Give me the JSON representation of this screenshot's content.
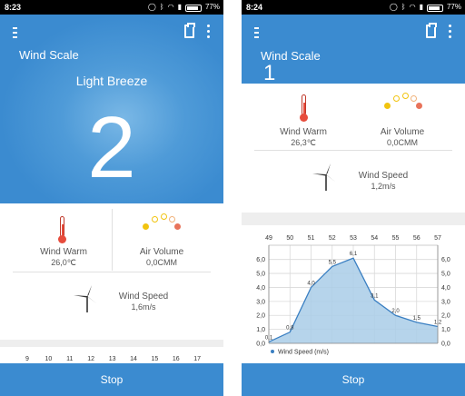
{
  "screen1": {
    "status": {
      "time": "8:23",
      "battery": "77%"
    },
    "title": "Wind Scale",
    "level_name": "Light Breeze",
    "level": "2",
    "wind_warm": {
      "label": "Wind Warm",
      "value": "26,0℃"
    },
    "air_volume": {
      "label": "Air Volume",
      "value": "0,0CMM"
    },
    "wind_speed": {
      "label": "Wind Speed",
      "value": "1,6m/s"
    },
    "top_ticks": [
      "9",
      "10",
      "11",
      "12",
      "13",
      "14",
      "15",
      "16",
      "17"
    ],
    "stop_label": "Stop"
  },
  "screen2": {
    "status": {
      "time": "8:24",
      "battery": "77%"
    },
    "title": "Wind Scale",
    "level": "1",
    "wind_warm": {
      "label": "Wind Warm",
      "value": "26,3℃"
    },
    "air_volume": {
      "label": "Air Volume",
      "value": "0,0CMM"
    },
    "wind_speed": {
      "label": "Wind Speed",
      "value": "1,2m/s"
    },
    "stop_label": "Stop"
  },
  "colors": {
    "accent": "#3b8bd0",
    "chart_line": "#3a7fc2",
    "chart_fill": "#a9cde8",
    "thermo": "#e74c3c"
  },
  "icons": [
    "menu-icon",
    "clipboard-icon",
    "more-vert-icon",
    "thermometer-icon",
    "air-volume-dots-icon",
    "wind-turbine-icon"
  ],
  "chart_data": {
    "type": "area",
    "x": [
      49,
      50,
      51,
      52,
      53,
      54,
      55,
      56,
      57
    ],
    "series": [
      {
        "name": "Wind Speed (m/s)",
        "values": [
          0.1,
          0.8,
          4.0,
          5.5,
          6.1,
          3.1,
          2.0,
          1.5,
          1.2
        ]
      }
    ],
    "point_labels": [
      "0,1",
      "0,8",
      "4,0",
      "5,5",
      "6,1",
      "3,1",
      "2,0",
      "1,5",
      "1,2"
    ],
    "y_ticks": [
      "0,0",
      "1,0",
      "2,0",
      "3,0",
      "4,0",
      "5,0",
      "6,0"
    ],
    "ylim": [
      0,
      6.5
    ],
    "grid": true,
    "legend": "bottom-left"
  }
}
